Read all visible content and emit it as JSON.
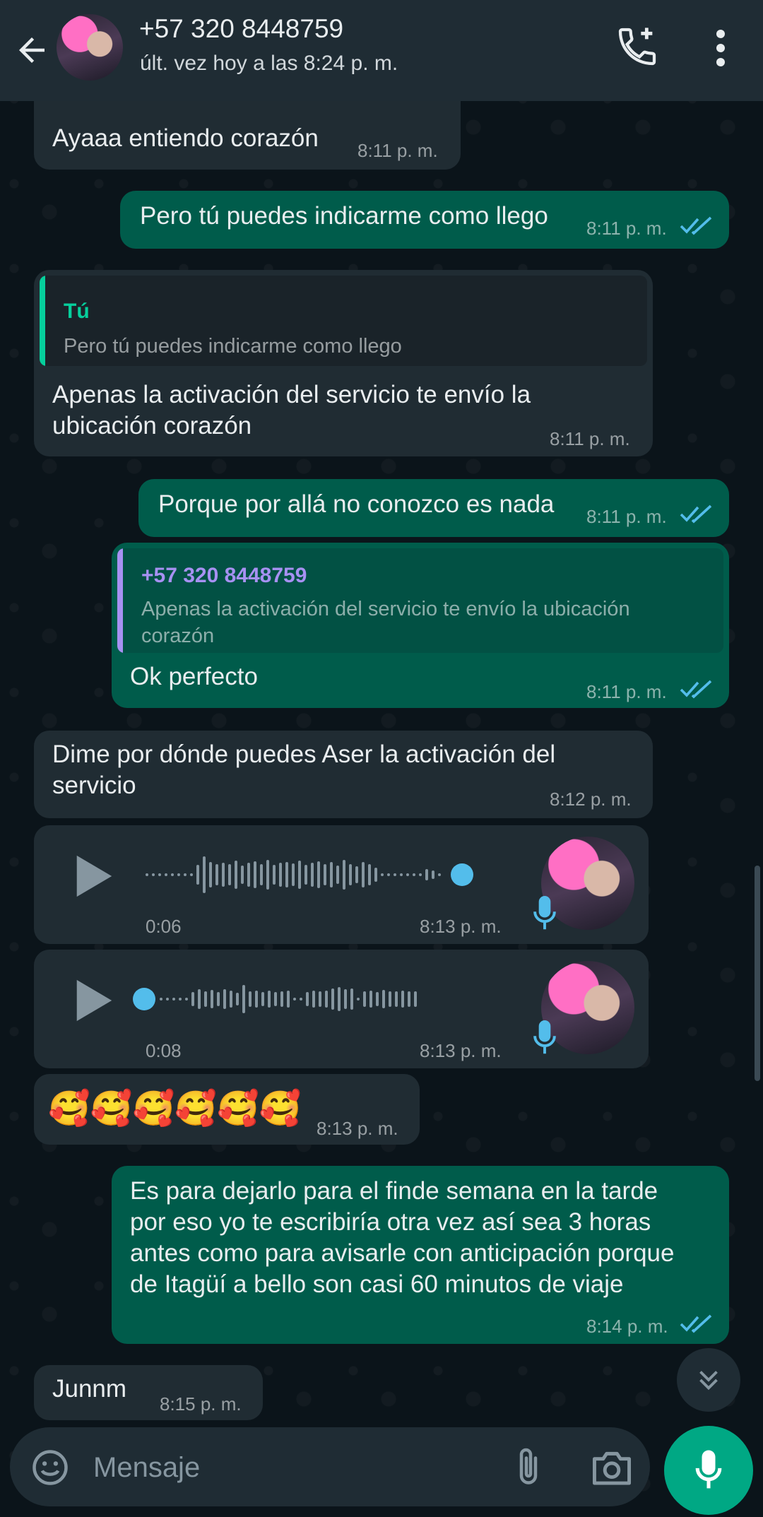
{
  "header": {
    "contact_name": "+57 320 8448759",
    "status": "últ. vez hoy a las 8:24 p. m.",
    "icons": {
      "back": "arrow-left-icon",
      "call": "add-call-icon",
      "menu": "more-vertical-icon"
    }
  },
  "colors": {
    "header_bg": "#1f2c34",
    "chat_bg": "#0b141a",
    "incoming_bubble": "#202c33",
    "outgoing_bubble": "#005c4b",
    "accent": "#00a884",
    "read_ticks": "#53bdeb",
    "quote_you": "#06cf9c",
    "quote_contact": "#a791f2"
  },
  "messages": [
    {
      "dir": "in",
      "text": "Ayaaa entiendo corazón",
      "time": "8:11 p. m."
    },
    {
      "dir": "out",
      "text": "Pero tú puedes indicarme como llego",
      "time": "8:11 p. m.",
      "read": true
    },
    {
      "dir": "in",
      "quote": {
        "author": "Tú",
        "text": "Pero tú puedes indicarme como llego"
      },
      "text_lines": [
        "Apenas la activación del servicio te envío la",
        "ubicación corazón"
      ],
      "time": "8:11 p. m."
    },
    {
      "dir": "out",
      "text": "Porque por allá no conozco es nada",
      "time": "8:11 p. m.",
      "read": true
    },
    {
      "dir": "out",
      "quote": {
        "author": "+57 320 8448759",
        "text_lines": [
          "Apenas la activación del servicio te envío la ubicación",
          "corazón"
        ]
      },
      "text": "Ok perfecto",
      "time": "8:11 p. m.",
      "read": true
    },
    {
      "dir": "in",
      "text_lines": [
        "Dime por dónde puedes Aser la activación del",
        "servicio"
      ],
      "time": "8:12 p. m."
    },
    {
      "dir": "in",
      "type": "voice",
      "duration": "0:06",
      "time": "8:13 p. m.",
      "progress": 0.92
    },
    {
      "dir": "in",
      "type": "voice",
      "duration": "0:08",
      "time": "8:13 p. m.",
      "progress": 0.0
    },
    {
      "dir": "in",
      "text": "🥰🥰🥰🥰🥰🥰",
      "time": "8:13 p. m."
    },
    {
      "dir": "out",
      "text_lines": [
        "Es para dejarlo para el finde semana en la tarde",
        "por eso yo te escribiría otra vez así sea 3 horas",
        "antes como para avisarle con anticipación porque",
        "de Itagüí a bello son casi 60 minutos de viaje"
      ],
      "time": "8:14 p. m.",
      "read": true
    },
    {
      "dir": "in",
      "text": "Junnm",
      "time": "8:15 p. m."
    }
  ],
  "composer": {
    "placeholder": "Mensaje",
    "icons": {
      "emoji": "emoji-icon",
      "attach": "paperclip-icon",
      "camera": "camera-icon",
      "send_voice": "microphone-icon",
      "scroll_down": "chevron-double-down-icon"
    }
  }
}
